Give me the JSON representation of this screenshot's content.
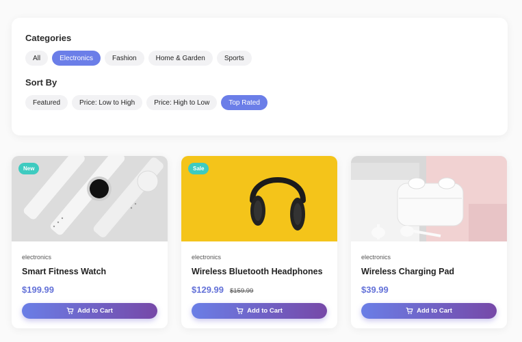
{
  "filters": {
    "categories_title": "Categories",
    "categories": [
      {
        "label": "All",
        "active": false
      },
      {
        "label": "Electronics",
        "active": true
      },
      {
        "label": "Fashion",
        "active": false
      },
      {
        "label": "Home & Garden",
        "active": false
      },
      {
        "label": "Sports",
        "active": false
      }
    ],
    "sort_title": "Sort By",
    "sort_options": [
      {
        "label": "Featured",
        "active": false
      },
      {
        "label": "Price: Low to High",
        "active": false
      },
      {
        "label": "Price: High to Low",
        "active": false
      },
      {
        "label": "Top Rated",
        "active": true
      }
    ]
  },
  "products": [
    {
      "badge": "New",
      "category": "electronics",
      "name": "Smart Fitness Watch",
      "price": "$199.99",
      "old_price": "",
      "button_label": "Add to Cart",
      "icon": "cart-icon"
    },
    {
      "badge": "Sale",
      "category": "electronics",
      "name": "Wireless Bluetooth Headphones",
      "price": "$129.99",
      "old_price": "$159.99",
      "button_label": "Add to Cart",
      "icon": "cart-icon"
    },
    {
      "badge": "",
      "category": "electronics",
      "name": "Wireless Charging Pad",
      "price": "$39.99",
      "old_price": "",
      "button_label": "Add to Cart",
      "icon": "cart-icon"
    }
  ],
  "colors": {
    "accent": "#6b7ee8",
    "badge": "#3ecbc0",
    "price": "#6371d8"
  }
}
